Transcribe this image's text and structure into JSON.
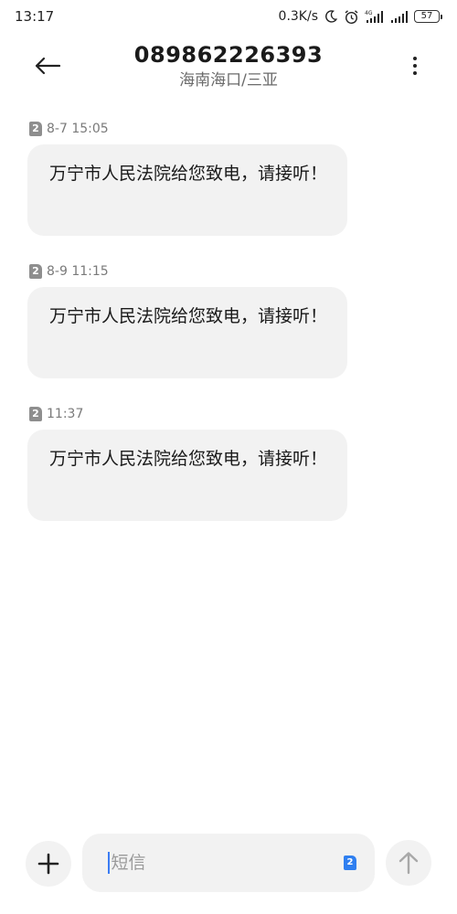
{
  "status_bar": {
    "time": "13:17",
    "network_speed": "0.3K/s",
    "signal_label": "4G",
    "battery": "57"
  },
  "header": {
    "number": "089862226393",
    "location": "海南海口/三亚"
  },
  "messages": [
    {
      "sim": "2",
      "timestamp": "8-7 15:05",
      "text": "万宁市人民法院给您致电，请接听！"
    },
    {
      "sim": "2",
      "timestamp": "8-9 11:15",
      "text": "万宁市人民法院给您致电，请接听！"
    },
    {
      "sim": "2",
      "timestamp": "11:37",
      "text": "万宁市人民法院给您致电，请接听！"
    }
  ],
  "composer": {
    "placeholder": "短信",
    "sim": "2"
  },
  "colors": {
    "bubble": "#f2f2f2",
    "sim_badge": "#8e8e8e",
    "composer_sim": "#2f7ff0",
    "caret": "#3b7cf4"
  },
  "icons": {
    "back": "arrow-left-icon",
    "more": "more-vertical-icon",
    "add": "plus-icon",
    "send": "arrow-up-icon"
  }
}
